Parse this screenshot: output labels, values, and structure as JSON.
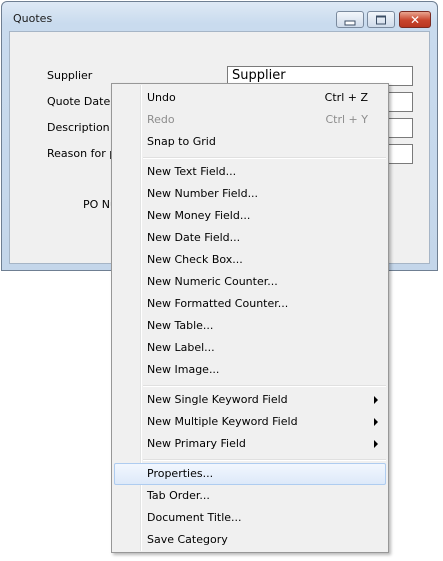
{
  "window": {
    "title": "Quotes",
    "controls": {
      "minimize_icon": "minimize-icon",
      "maximize_icon": "maximize-icon",
      "close_icon": "close-icon",
      "close_glyph": "✕"
    }
  },
  "form": {
    "fields": [
      {
        "label": "Supplier",
        "value": "Supplier"
      },
      {
        "label": "Quote Date",
        "value": ""
      },
      {
        "label": "Description of",
        "value": ""
      },
      {
        "label": "Reason for pu",
        "value": ""
      }
    ],
    "po_label": "PO Nu"
  },
  "context_menu": {
    "items": [
      {
        "label": "Undo",
        "shortcut": "Ctrl + Z",
        "enabled": true
      },
      {
        "label": "Redo",
        "shortcut": "Ctrl + Y",
        "enabled": false
      },
      {
        "label": "Snap to Grid"
      },
      {
        "label": "New Text Field..."
      },
      {
        "label": "New Number Field..."
      },
      {
        "label": "New Money Field..."
      },
      {
        "label": "New Date Field..."
      },
      {
        "label": "New Check Box..."
      },
      {
        "label": "New Numeric Counter..."
      },
      {
        "label": "New Formatted Counter..."
      },
      {
        "label": "New Table..."
      },
      {
        "label": "New Label..."
      },
      {
        "label": "New Image..."
      },
      {
        "label": "New Single Keyword Field",
        "submenu": true
      },
      {
        "label": "New Multiple Keyword Field",
        "submenu": true
      },
      {
        "label": "New Primary Field",
        "submenu": true
      },
      {
        "label": "Properties...",
        "highlighted": true
      },
      {
        "label": "Tab Order..."
      },
      {
        "label": "Document Title..."
      },
      {
        "label": "Save Category"
      }
    ]
  },
  "colors": {
    "menu_highlight": "#dde9f9",
    "menu_highlight_border": "#aeccf0",
    "disabled_text": "#8d8d8d",
    "close_button": "#c8452d"
  }
}
